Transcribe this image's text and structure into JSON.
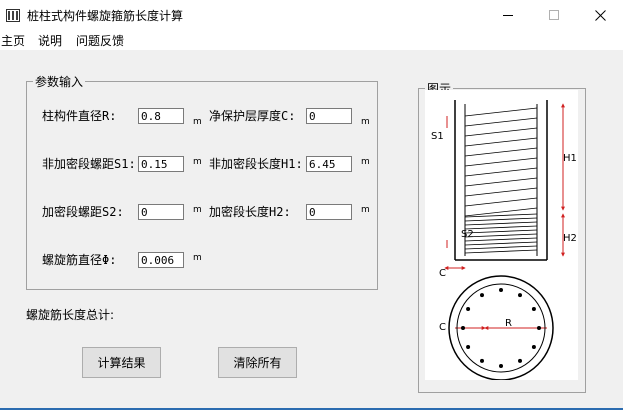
{
  "window": {
    "title": "桩柱式构件螺旋箍筋长度计算",
    "icons": {
      "app": "app-building-icon",
      "minimize": "minimize-icon",
      "maximize": "maximize-icon",
      "close": "close-icon"
    }
  },
  "menu": {
    "items": [
      "主页",
      "说明",
      "问题反馈"
    ]
  },
  "params": {
    "legend": "参数输入",
    "fields": [
      {
        "label": "柱构件直径R:",
        "value": "0.8",
        "unit": "m"
      },
      {
        "label": "净保护层厚度C:",
        "value": "0",
        "unit": "m"
      },
      {
        "label": "非加密段螺距S1:",
        "value": "0.15",
        "unit": "m"
      },
      {
        "label": "非加密段长度H1:",
        "value": "6.45",
        "unit": "m"
      },
      {
        "label": "加密段螺距S2:",
        "value": "0",
        "unit": "m"
      },
      {
        "label": "加密段长度H2:",
        "value": "0",
        "unit": "m"
      },
      {
        "label": "螺旋筋直径Φ:",
        "value": "0.006",
        "unit": "m"
      }
    ]
  },
  "result": {
    "label": "螺旋筋长度总计:"
  },
  "buttons": {
    "calculate": "计算结果",
    "clear": "清除所有"
  },
  "diagram": {
    "legend": "图示",
    "labels": {
      "s1": "S1",
      "h1": "H1",
      "s2": "S2",
      "h2": "H2",
      "c": "C",
      "c2": "C",
      "r": "R"
    }
  }
}
